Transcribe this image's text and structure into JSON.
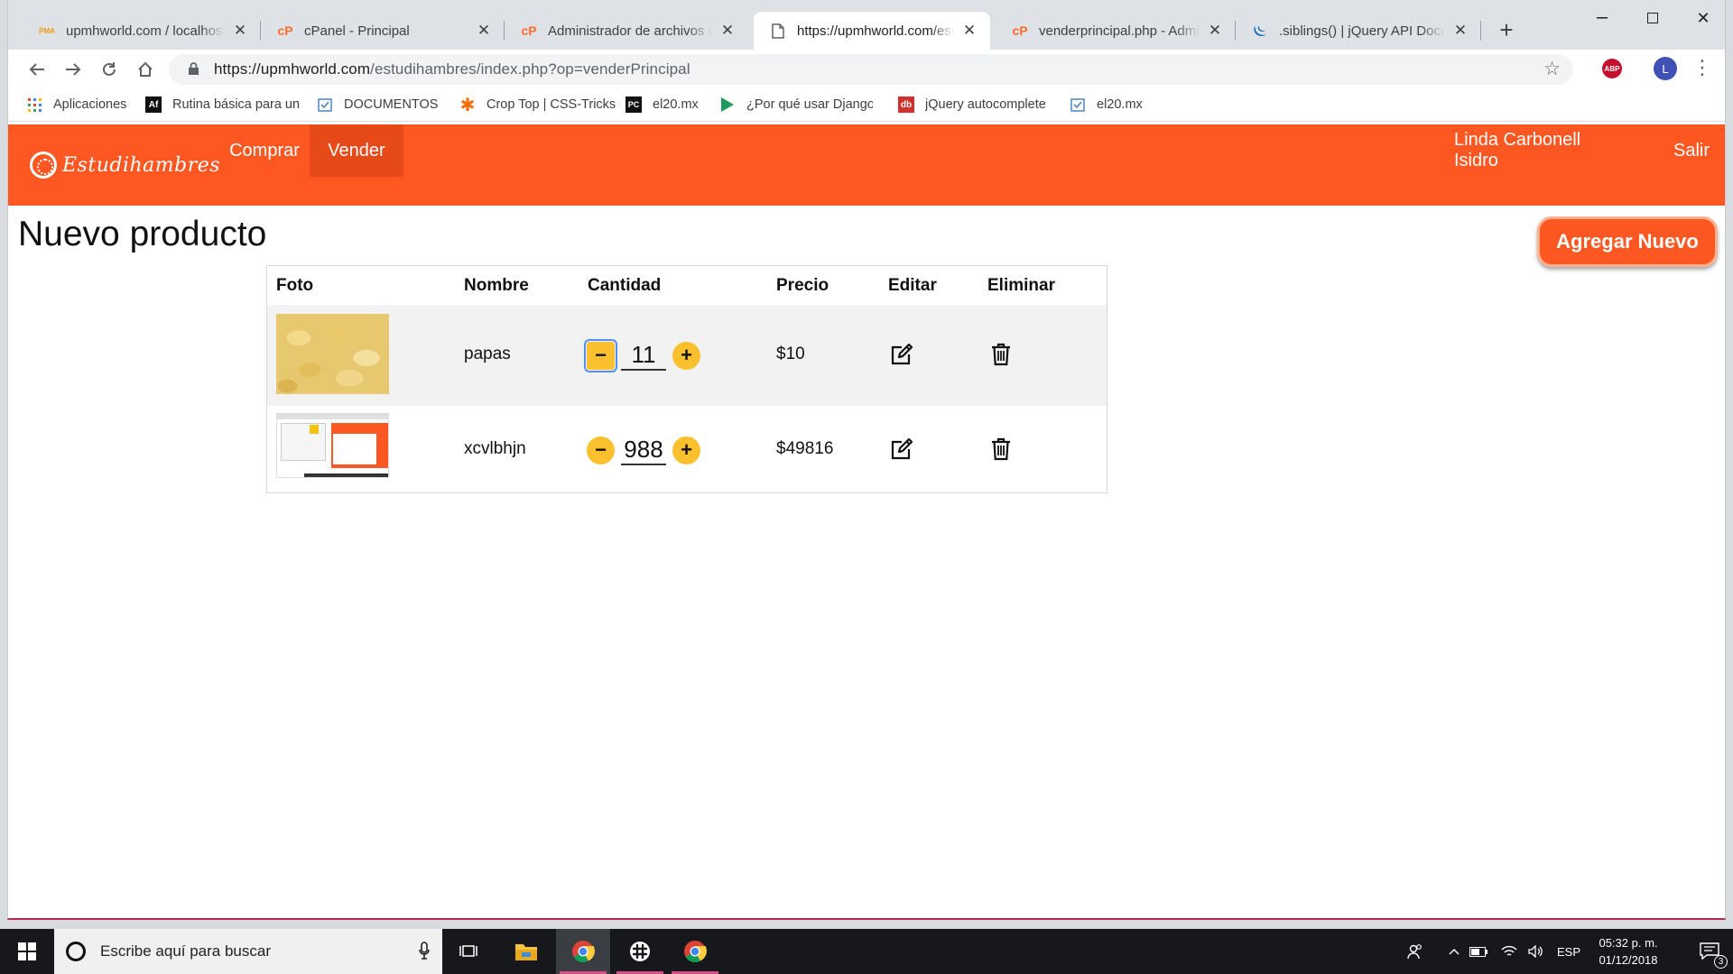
{
  "browser": {
    "tabs": [
      {
        "title": "upmhworld.com / localhost",
        "icon": "phpmyadmin-icon",
        "icon_text": "PMA"
      },
      {
        "title": "cPanel - Principal",
        "icon": "cpanel-icon",
        "icon_text": "cP"
      },
      {
        "title": "Administrador de archivos de cPanel",
        "icon": "cpanel-icon",
        "icon_text": "cP"
      },
      {
        "title": "https://upmhworld.com/estudihambres",
        "icon": "page-icon",
        "icon_text": ""
      },
      {
        "title": "venderprincipal.php - Administrador",
        "icon": "cpanel-icon",
        "icon_text": "cP"
      },
      {
        "title": ".siblings() | jQuery API Documentation",
        "icon": "jquery-icon",
        "icon_text": ""
      }
    ],
    "active_tab_index": 3,
    "url_host": "https://upmhworld.com",
    "url_path": "/estudihambres/index.php?op=venderPrincipal",
    "abp_label": "ABP",
    "profile_initial": "L",
    "bookmarks": [
      {
        "label": "Aplicaciones",
        "icon": "apps-grid-icon"
      },
      {
        "label": "Rutina básica para un",
        "icon": "af-icon"
      },
      {
        "label": "DOCUMENTOS",
        "icon": "checklist-icon"
      },
      {
        "label": "Crop Top | CSS-Tricks",
        "icon": "asterisk-icon"
      },
      {
        "label": "el20.mx",
        "icon": "pycharm-icon"
      },
      {
        "label": "¿Por qué usar Django",
        "icon": "play-icon"
      },
      {
        "label": "jQuery autocomplete",
        "icon": "db-icon"
      },
      {
        "label": "el20.mx",
        "icon": "checklist-icon"
      }
    ]
  },
  "app": {
    "brand": "Estudihambres",
    "nav": [
      {
        "label": "Comprar",
        "active": false
      },
      {
        "label": "Vender",
        "active": true
      }
    ],
    "user_name": "Linda Carbonell Isidro",
    "logout_label": "Salir",
    "accent_color": "#ff5722"
  },
  "main": {
    "title": "Nuevo producto",
    "add_button": "Agregar Nuevo",
    "table": {
      "headers": [
        "Foto",
        "Nombre",
        "Cantidad",
        "Precio",
        "Editar",
        "Eliminar"
      ],
      "rows": [
        {
          "photo": "potato-chips-photo",
          "name": "papas",
          "quantity": "11",
          "price": "$10"
        },
        {
          "photo": "screenshot-photo",
          "name": "xcvlbhjn",
          "quantity": "988",
          "price": "$49816"
        }
      ]
    }
  },
  "taskbar": {
    "search_placeholder": "Escribe aquí para buscar",
    "language": "ESP",
    "time": "05:32 p. m.",
    "date": "01/12/2018",
    "notification_count": "3"
  }
}
